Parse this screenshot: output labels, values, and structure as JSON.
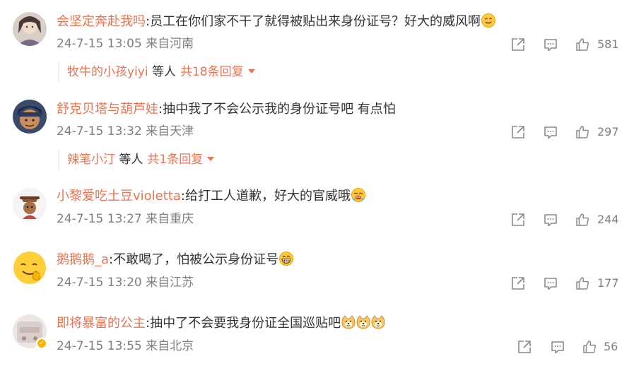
{
  "comments": [
    {
      "username": "会坚定奔赴我吗",
      "text": ":员工在你们家不干了就得被贴出来身份证号？好大的威风啊",
      "emoji": [
        "smile-emoji"
      ],
      "time": "24-7-15 13:05",
      "location": "来自河南",
      "likes": "581",
      "replies": {
        "name": "牧牛的小孩yiyi",
        "mid": "等人",
        "count": "共18条回复"
      }
    },
    {
      "username": "舒克贝塔与葫芦娃",
      "text": ":抽中我了不会公示我的身份证号吧 有点怕",
      "emoji": [],
      "time": "24-7-15 13:32",
      "location": "来自天津",
      "likes": "297",
      "replies": {
        "name": "辣笔小汀",
        "mid": "等人",
        "count": "共1条回复"
      }
    },
    {
      "username": "小黎爱吃土豆violetta",
      "text": ":给打工人道歉，好大的官威哦",
      "emoji": [
        "hot-face-emoji"
      ],
      "time": "24-7-15 13:27",
      "location": "来自重庆",
      "likes": "244"
    },
    {
      "username": "鹅鹅鹅_a",
      "text": ":不敢喝了，怕被公示身份证号",
      "emoji": [
        "grin-emoji"
      ],
      "time": "24-7-15 13:20",
      "location": "来自江苏",
      "likes": "177"
    },
    {
      "username": "即将暴富的公主",
      "text": ":抽中了不会要我身份证全国巡贴吧",
      "emoji": [
        "doge-emoji",
        "doge-emoji",
        "doge-emoji"
      ],
      "time": "24-7-15 13:55",
      "location": "来自北京",
      "likes": "56"
    }
  ],
  "icons": {
    "share": "share-icon",
    "comment": "comment-icon",
    "like": "like-icon"
  },
  "colors": {
    "username": "#eb7350",
    "meta": "#808080",
    "text": "#333333",
    "verified_badge": "#f7b500"
  }
}
